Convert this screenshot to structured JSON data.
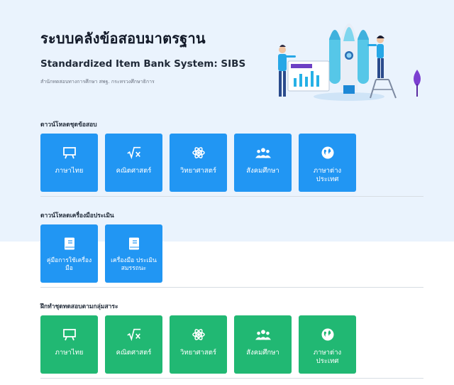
{
  "header": {
    "title": "ระบบคลังข้อสอบมาตรฐาน",
    "subtitle": "Standardized Item Bank System: SIBS",
    "org": "สำนักทดสอบทางการศึกษา สพฐ. กระทรวงศึกษาธิการ"
  },
  "sections": {
    "download_exams": {
      "label": "ดาวน์โหลดชุดข้อสอบ",
      "tiles": [
        {
          "label": "ภาษาไทย",
          "icon": "chalkboard-icon"
        },
        {
          "label": "คณิตศาสตร์",
          "icon": "math-icon"
        },
        {
          "label": "วิทยาศาสตร์",
          "icon": "atom-icon"
        },
        {
          "label": "สังคมศึกษา",
          "icon": "people-icon"
        },
        {
          "label": "ภาษาต่าง ประเทศ",
          "icon": "globe-icon"
        }
      ]
    },
    "download_tools": {
      "label": "ดาวน์โหลดเครื่องมือประเมิน",
      "tiles": [
        {
          "label": "คู่มือการใช้เครื่อง มือ",
          "icon": "book-icon"
        },
        {
          "label": "เครื่องมือ ประเมิน สมรรถนะ",
          "icon": "book-icon"
        }
      ]
    },
    "practice": {
      "label": "ฝึกทำชุดทดสอบตามกลุ่มสาระ",
      "tiles": [
        {
          "label": "ภาษาไทย",
          "icon": "chalkboard-icon"
        },
        {
          "label": "คณิตศาสตร์",
          "icon": "math-icon"
        },
        {
          "label": "วิทยาศาสตร์",
          "icon": "atom-icon"
        },
        {
          "label": "สังคมศึกษา",
          "icon": "people-icon"
        },
        {
          "label": "ภาษาต่าง ประเทศ",
          "icon": "globe-icon"
        }
      ]
    }
  },
  "colors": {
    "hero_bg": "#eaf3fd",
    "tile_blue": "#2196f3",
    "tile_green": "#21b873"
  }
}
